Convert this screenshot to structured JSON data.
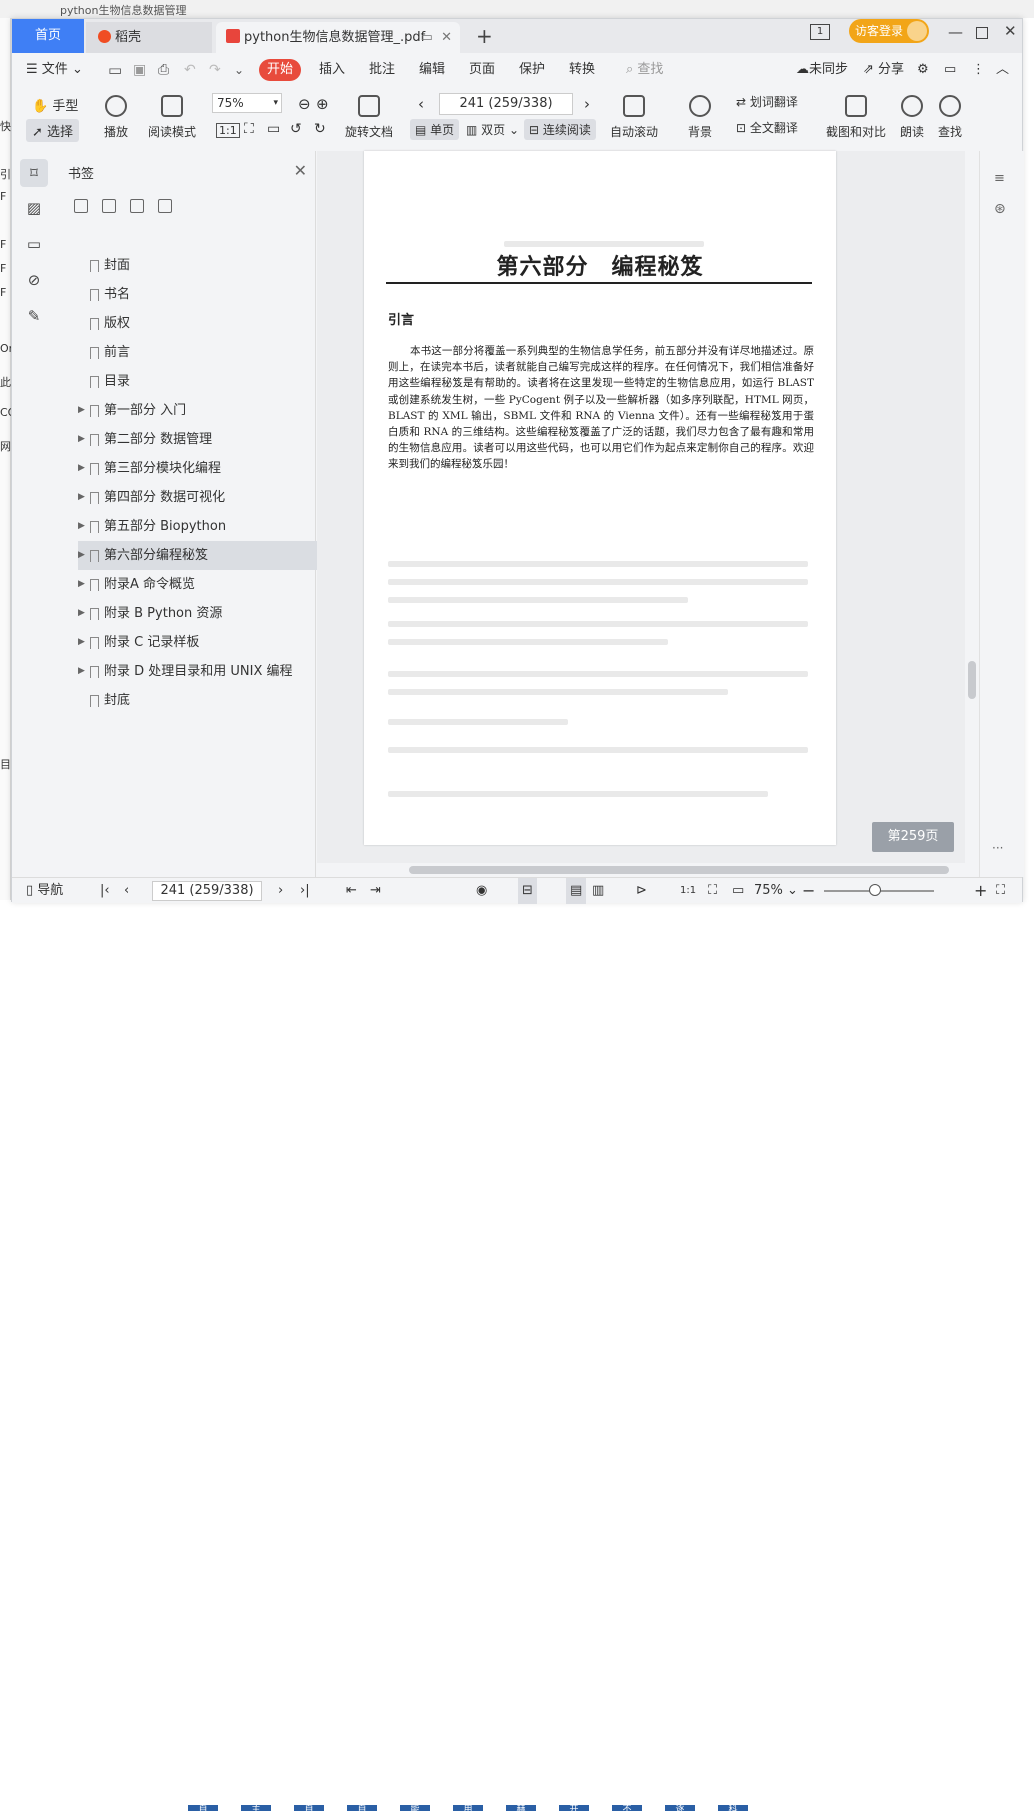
{
  "background": {
    "top_title": "python生物信息数据管理",
    "left_chars": [
      "快",
      "引",
      "F",
      "F",
      "F",
      "F",
      "Or",
      "此",
      "CO",
      "网",
      "目"
    ],
    "bottom_chars": [
      "自",
      "主",
      "自",
      "自",
      "能",
      "用",
      "赫",
      "开",
      "不",
      "逐",
      "科"
    ]
  },
  "tabs": {
    "home": "首页",
    "daoke": "稻壳",
    "pdf": "python生物信息数据管理_.pdf",
    "add": "+"
  },
  "titlebar": {
    "guest_login": "访客登录",
    "page_indicator": "1"
  },
  "menu": {
    "file": "文件",
    "start": "开始",
    "insert": "插入",
    "annotate": "批注",
    "edit": "编辑",
    "page": "页面",
    "protect": "保护",
    "convert": "转换",
    "search": "查找",
    "sync": "未同步",
    "share": "分享"
  },
  "ribbon": {
    "hand": "手型",
    "select": "选择",
    "play": "播放",
    "read_mode": "阅读模式",
    "zoom": "75%",
    "rotate": "旋转文档",
    "page_value": "241 (259/338)",
    "single": "单页",
    "double": "双页",
    "continuous": "连续阅读",
    "auto_scroll": "自动滚动",
    "background": "背景",
    "word_translate": "划词翻译",
    "full_translate": "全文翻译",
    "compare": "截图和对比",
    "read_aloud": "朗读",
    "find": "查找"
  },
  "panel": {
    "title": "书签",
    "bookmarks": [
      {
        "label": "封面",
        "expandable": false
      },
      {
        "label": "书名",
        "expandable": false
      },
      {
        "label": "版权",
        "expandable": false
      },
      {
        "label": "前言",
        "expandable": false
      },
      {
        "label": "目录",
        "expandable": false
      },
      {
        "label": "第一部分 入门",
        "expandable": true
      },
      {
        "label": "第二部分 数据管理",
        "expandable": true
      },
      {
        "label": "第三部分模块化编程",
        "expandable": true
      },
      {
        "label": "第四部分 数据可视化",
        "expandable": true
      },
      {
        "label": "第五部分 Biopython",
        "expandable": true
      },
      {
        "label": "第六部分编程秘笈",
        "expandable": true,
        "selected": true
      },
      {
        "label": "附录A 命令概览",
        "expandable": true
      },
      {
        "label": "附录 B Python 资源",
        "expandable": true
      },
      {
        "label": "附录 C 记录样板",
        "expandable": true
      },
      {
        "label": "附录 D 处理目录和用 UNIX 编程",
        "expandable": true
      },
      {
        "label": "封底",
        "expandable": false
      }
    ]
  },
  "document": {
    "heading": "第六部分　编程秘笈",
    "subheading": "引言",
    "body": "本书这一部分将覆盖一系列典型的生物信息学任务，前五部分并没有详尽地描述过。原则上，在读完本书后，读者就能自己编写完成这样的程序。在任何情况下，我们相信准备好用这些编程秘笈是有帮助的。读者将在这里发现一些特定的生物信息应用，如运行 BLAST 或创建系统发生树，一些 PyCogent 例子以及一些解析器（如多序列联配，HTML 网页，BLAST 的 XML 输出，SBML 文件和 RNA 的 Vienna 文件）。还有一些编程秘笈用于蛋白质和 RNA 的三维结构。这些编程秘笈覆盖了广泛的话题，我们尽力包含了最有趣和常用的生物信息应用。读者可以用这些代码，也可以用它们作为起点来定制你自己的程序。欢迎来到我们的编程秘笈乐园！",
    "page_badge": "第259页"
  },
  "statusbar": {
    "nav": "导航",
    "page_value": "241 (259/338)",
    "zoom": "75%"
  },
  "colors": {
    "accent": "#3f7ff5",
    "start": "#e84b3c",
    "guest": "#f2a518"
  }
}
